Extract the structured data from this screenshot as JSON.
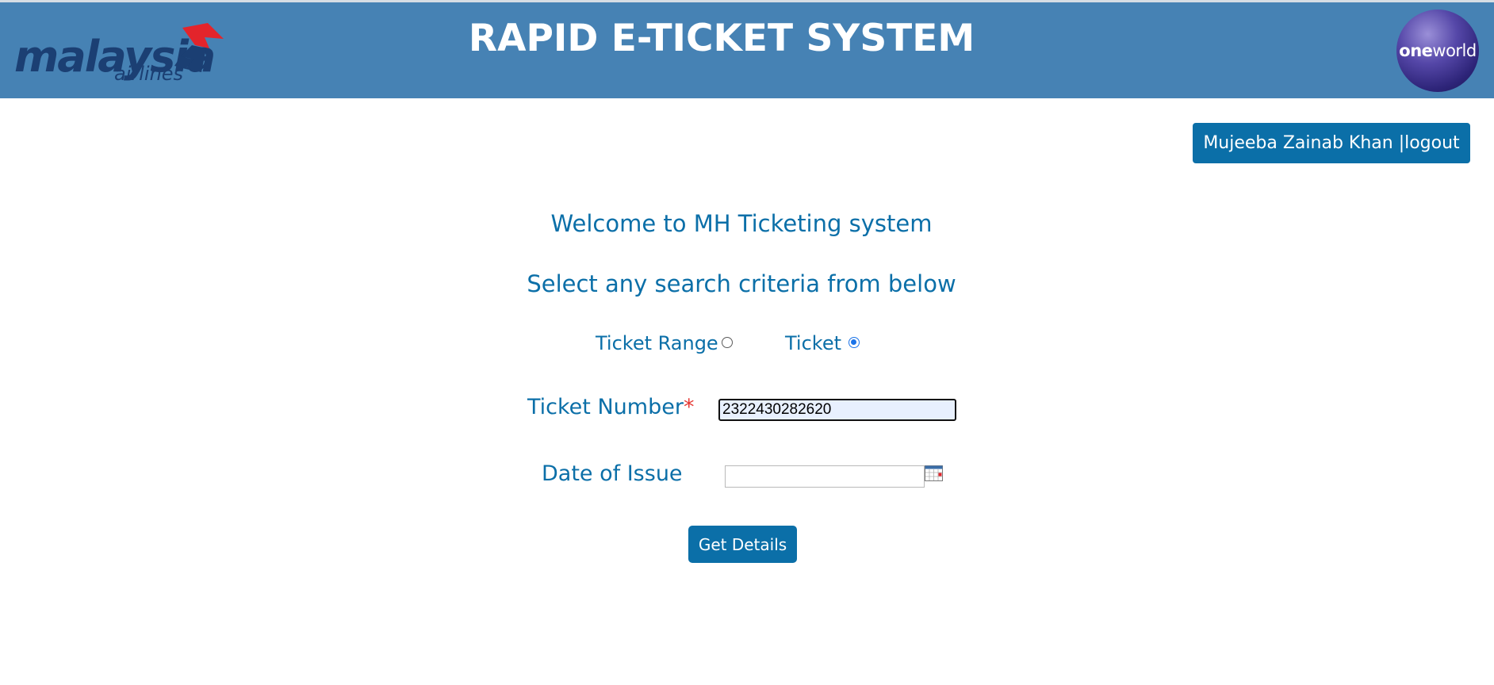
{
  "header": {
    "title": "RAPID E-TICKET SYSTEM",
    "airline_logo": {
      "wordmark": "malaysia",
      "subtext": "airlines",
      "icon": "malaysia-airlines-kite-logo"
    },
    "alliance_logo": {
      "prefix": "one",
      "suffix": "world",
      "icon": "oneworld-globe-logo"
    }
  },
  "user": {
    "button_label": "Mujeeba Zainab Khan |logout"
  },
  "main": {
    "welcome": "Welcome to MH Ticketing system",
    "criteria_prompt": "Select any search criteria from below",
    "search_options": [
      {
        "label": "Ticket Range",
        "selected": false
      },
      {
        "label": "Ticket",
        "selected": true
      }
    ],
    "ticket_number": {
      "label": "Ticket Number",
      "required_marker": "*",
      "value": "2322430282620"
    },
    "date_of_issue": {
      "label": "Date of Issue",
      "value": "",
      "icon": "calendar-icon"
    },
    "submit_label": "Get Details"
  },
  "colors": {
    "header_bg": "#4682b4",
    "accent": "#0b6fa8",
    "required": "#e53935",
    "radio_selected": "#1a73e8"
  }
}
